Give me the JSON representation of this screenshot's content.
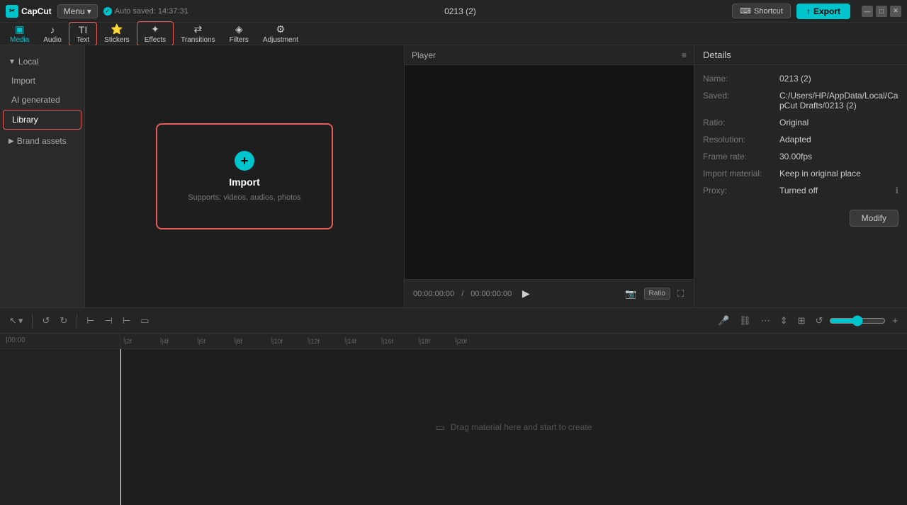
{
  "app": {
    "name": "CapCut",
    "logo_text": "CC"
  },
  "titlebar": {
    "menu_label": "Menu",
    "menu_arrow": "▾",
    "autosave_text": "Auto saved: 14:37:31",
    "project_title": "0213 (2)",
    "shortcut_label": "Shortcut",
    "shortcut_icon": "⌨",
    "export_label": "Export",
    "export_icon": "↑"
  },
  "toolbar": {
    "items": [
      {
        "id": "media",
        "icon": "▣",
        "label": "Media",
        "active": true
      },
      {
        "id": "audio",
        "icon": "♪",
        "label": "Audio",
        "active": false
      },
      {
        "id": "text",
        "icon": "TI",
        "label": "Text",
        "active": false
      },
      {
        "id": "stickers",
        "icon": "⭐",
        "label": "Stickers",
        "active": false
      },
      {
        "id": "effects",
        "icon": "✦",
        "label": "Effects",
        "active": false
      },
      {
        "id": "transitions",
        "icon": "◧",
        "label": "Transitions",
        "active": false
      },
      {
        "id": "filters",
        "icon": "◈",
        "label": "Filters",
        "active": false
      },
      {
        "id": "adjustment",
        "icon": "⚙",
        "label": "Adjustment",
        "active": false
      }
    ]
  },
  "sidebar": {
    "local_header": "Local",
    "items": [
      {
        "id": "import",
        "label": "Import"
      },
      {
        "id": "ai-generated",
        "label": "AI generated"
      },
      {
        "id": "library",
        "label": "Library",
        "active": true
      }
    ],
    "brand_assets": "Brand assets"
  },
  "media_area": {
    "import_icon": "+",
    "import_label": "Import",
    "import_sub": "Supports: videos, audios, photos"
  },
  "player": {
    "title": "Player",
    "time_current": "00:00:00:00",
    "time_total": "00:00:00:00",
    "ratio_label": "Ratio"
  },
  "details": {
    "title": "Details",
    "rows": [
      {
        "label": "Name:",
        "value": "0213 (2)"
      },
      {
        "label": "Saved:",
        "value": "C:/Users/HP/AppData/Local/CapCut Drafts/0213 (2)"
      },
      {
        "label": "Ratio:",
        "value": "Original"
      },
      {
        "label": "Resolution:",
        "value": "Adapted"
      },
      {
        "label": "Frame rate:",
        "value": "30.00fps"
      },
      {
        "label": "Import material:",
        "value": "Keep in original place"
      },
      {
        "label": "Proxy:",
        "value": "Turned off"
      }
    ],
    "modify_label": "Modify"
  },
  "timeline": {
    "ruler_marks": [
      "00:00",
      "|2f",
      "|4f",
      "|6f",
      "|8f",
      "|10f",
      "|12f",
      "|14f",
      "|16f",
      "|18f",
      "|20f"
    ],
    "drag_hint": "Drag material here and start to create"
  },
  "colors": {
    "accent": "#00c4cc",
    "border_red": "#e85c5c",
    "bg_dark": "#1a1a1a",
    "bg_medium": "#252525",
    "bg_light": "#2a2a2a"
  }
}
